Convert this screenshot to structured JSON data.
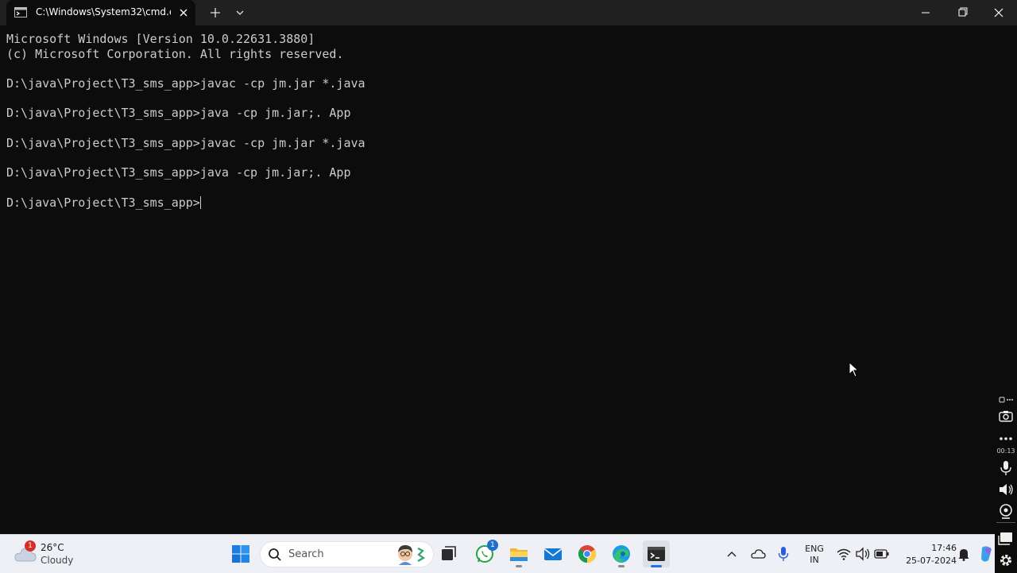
{
  "window": {
    "tab_title": "C:\\Windows\\System32\\cmd.e",
    "new_tab_symbol": "+"
  },
  "terminal": {
    "lines": [
      "Microsoft Windows [Version 10.0.22631.3880]",
      "(c) Microsoft Corporation. All rights reserved.",
      "",
      "D:\\java\\Project\\T3_sms_app>javac -cp jm.jar *.java",
      "",
      "D:\\java\\Project\\T3_sms_app>java -cp jm.jar;. App",
      "",
      "D:\\java\\Project\\T3_sms_app>javac -cp jm.jar *.java",
      "",
      "D:\\java\\Project\\T3_sms_app>java -cp jm.jar;. App",
      "",
      "D:\\java\\Project\\T3_sms_app>"
    ],
    "colors": {
      "background": "#0c0c0c",
      "text": "#cccccc"
    }
  },
  "recorder": {
    "timer": "00:13"
  },
  "taskbar": {
    "weather": {
      "temperature": "26°C",
      "condition": "Cloudy",
      "badge": "1"
    },
    "search_placeholder": "Search",
    "whatsapp_badge": "1",
    "language": {
      "line1": "ENG",
      "line2": "IN"
    },
    "clock": {
      "time": "17:46",
      "date": "25-07-2024"
    },
    "icons": [
      "windows-start-icon",
      "search-icon",
      "task-view-icon",
      "whatsapp-icon",
      "file-explorer-icon",
      "mail-icon",
      "chrome-icon",
      "edge-icon",
      "terminal-icon"
    ]
  }
}
